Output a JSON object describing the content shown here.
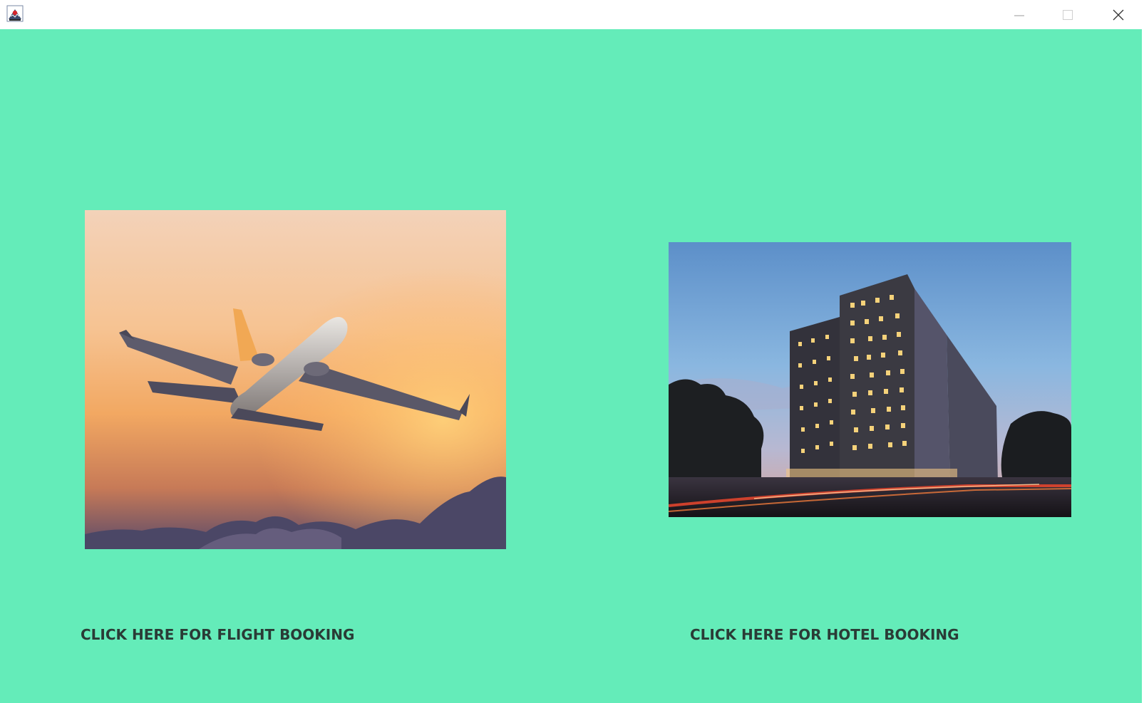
{
  "window": {
    "app_icon": "java-app-icon",
    "controls": {
      "minimize_icon": "minimize-icon",
      "maximize_icon": "maximize-icon",
      "close_icon": "close-icon"
    }
  },
  "main": {
    "background_color": "#64ecb9",
    "flight": {
      "image": "airplane-sunset-photo",
      "label": "CLICK HERE FOR FLIGHT BOOKING"
    },
    "hotel": {
      "image": "hotel-building-night-photo",
      "label": "CLICK HERE FOR HOTEL BOOKING"
    }
  }
}
